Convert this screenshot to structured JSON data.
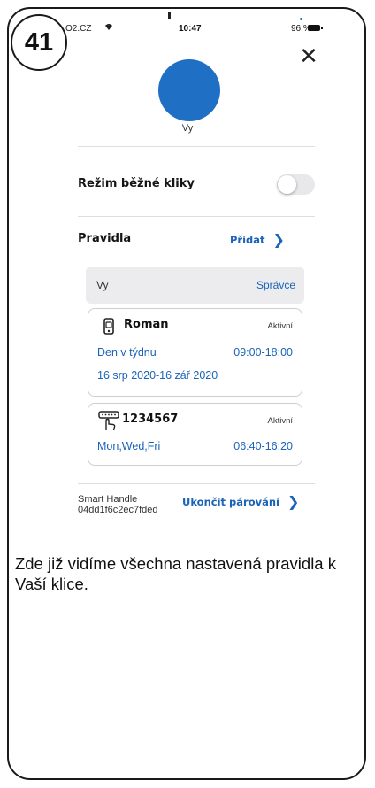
{
  "step_number": "41",
  "status_bar": {
    "carrier": "O2.CZ",
    "time": "10:47",
    "battery": "96 %"
  },
  "profile": {
    "name": "Vy",
    "avatar_color": "#1f6fc5"
  },
  "handle_mode": {
    "label": "Režim běžné kliky",
    "enabled": false
  },
  "rules": {
    "heading": "Pravidla",
    "add_label": "Přidat",
    "owner": {
      "name": "Vy",
      "role": "Správce"
    },
    "cards": [
      {
        "icon": "phone-key-icon",
        "title": "Roman",
        "status": "Aktivní",
        "days": "Den v týdnu",
        "time": "09:00-18:00",
        "dates": "16 srp 2020-16 zář 2020"
      },
      {
        "icon": "keypad-code-icon",
        "title": "1234567",
        "status": "Aktivní",
        "days": "Mon,Wed,Fri",
        "time": "06:40-16:20"
      }
    ]
  },
  "device": {
    "name": "Smart Handle",
    "id": "04dd1f6c2ec7fded",
    "unpair_label": "Ukončit párování"
  },
  "caption": "Zde již vidíme všechna nastavená pravidla k Vaší klice.",
  "colors": {
    "accent": "#1a63b8",
    "toggle_off": "#e8e8ea",
    "card_border": "#cfcfd3"
  }
}
